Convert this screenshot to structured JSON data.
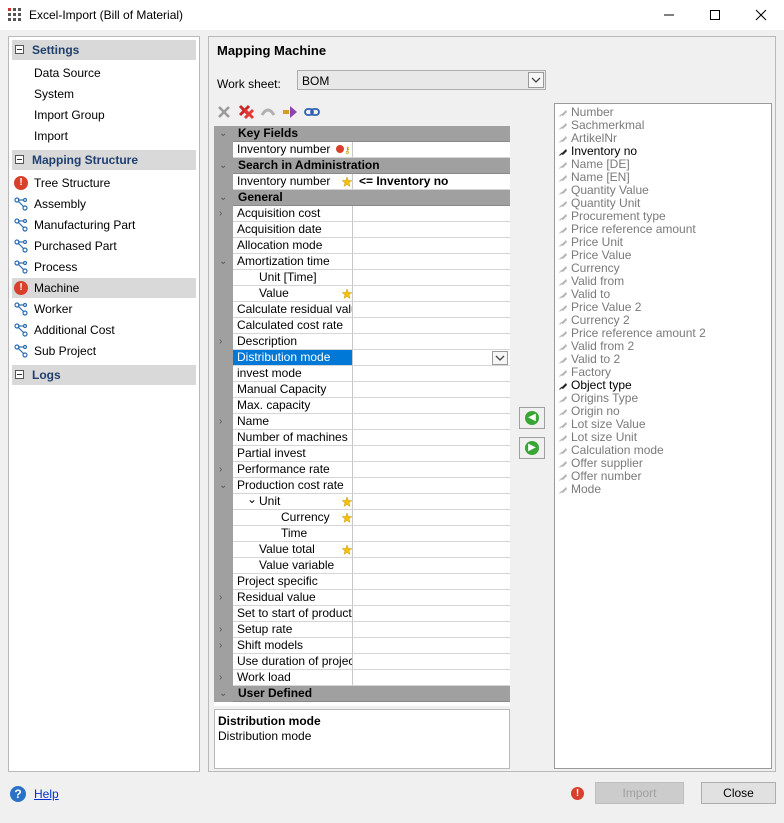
{
  "window": {
    "title": "Excel-Import (Bill of Material)"
  },
  "nav": {
    "settings_header": "Settings",
    "settings_items": [
      "Data Source",
      "System",
      "Import Group",
      "Import"
    ],
    "mapping_header": "Mapping Structure",
    "mapping_items": [
      {
        "label": "Tree Structure",
        "icon": "error-icon"
      },
      {
        "label": "Assembly",
        "icon": "structure-icon"
      },
      {
        "label": "Manufacturing Part",
        "icon": "structure-icon"
      },
      {
        "label": "Purchased Part",
        "icon": "structure-icon"
      },
      {
        "label": "Process",
        "icon": "structure-icon"
      },
      {
        "label": "Machine",
        "icon": "error-icon",
        "selected": true
      },
      {
        "label": "Worker",
        "icon": "structure-icon"
      },
      {
        "label": "Additional Cost",
        "icon": "structure-icon"
      },
      {
        "label": "Sub Project",
        "icon": "structure-icon"
      }
    ],
    "logs_header": "Logs"
  },
  "main": {
    "title": "Mapping Machine",
    "worksheet_label": "Work sheet:",
    "worksheet_value": "BOM"
  },
  "grid": {
    "categories": {
      "key_fields": "Key Fields",
      "search": "Search in Administration",
      "general": "General",
      "user_defined": "User Defined"
    },
    "key_rows": [
      {
        "label": "Inventory number",
        "value": ""
      }
    ],
    "search_rows": [
      {
        "label": "Inventory number",
        "value": "<= Inventory no"
      }
    ],
    "general_rows": [
      {
        "label": "Acquisition cost",
        "chev": "›"
      },
      {
        "label": "Acquisition date"
      },
      {
        "label": "Allocation mode"
      },
      {
        "label": "Amortization time",
        "chev": "⌄"
      },
      {
        "label": "Unit  [Time]",
        "indent": 1
      },
      {
        "label": "Value",
        "indent": 1,
        "star": true
      },
      {
        "label": "Calculate residual value"
      },
      {
        "label": "Calculated cost rate"
      },
      {
        "label": "Description",
        "chev": "›"
      },
      {
        "label": "Distribution mode",
        "selected": true,
        "dropdown": true
      },
      {
        "label": "invest mode"
      },
      {
        "label": "Manual Capacity"
      },
      {
        "label": "Max. capacity"
      },
      {
        "label": "Name",
        "chev": "›"
      },
      {
        "label": "Number of machines"
      },
      {
        "label": "Partial invest"
      },
      {
        "label": "Performance rate",
        "chev": "›"
      },
      {
        "label": "Production cost rate",
        "chev": "⌄"
      },
      {
        "label": "Unit",
        "indent": 1,
        "subchev": "⌄",
        "star": true
      },
      {
        "label": "Currency",
        "indent": 2,
        "star": true
      },
      {
        "label": "Time",
        "indent": 2
      },
      {
        "label": "Value total",
        "indent": 1,
        "star": true
      },
      {
        "label": "Value variable",
        "indent": 1
      },
      {
        "label": "Project specific"
      },
      {
        "label": "Residual value",
        "chev": "›"
      },
      {
        "label": "Set to start of production"
      },
      {
        "label": "Setup rate",
        "chev": "›"
      },
      {
        "label": "Shift models",
        "chev": "›"
      },
      {
        "label": "Use duration of projects"
      },
      {
        "label": "Work load",
        "chev": "›"
      }
    ]
  },
  "description": {
    "title": "Distribution mode",
    "text": "Distribution mode"
  },
  "fields": [
    {
      "label": "Number"
    },
    {
      "label": "Sachmerkmal"
    },
    {
      "label": "ArtikelNr"
    },
    {
      "label": "Inventory no",
      "used": true
    },
    {
      "label": "Name [DE]"
    },
    {
      "label": "Name [EN]"
    },
    {
      "label": "Quantity Value"
    },
    {
      "label": "Quantity Unit"
    },
    {
      "label": "Procurement type"
    },
    {
      "label": "Price reference amount"
    },
    {
      "label": "Price Unit"
    },
    {
      "label": "Price Value"
    },
    {
      "label": "Currency"
    },
    {
      "label": "Valid from"
    },
    {
      "label": "Valid to"
    },
    {
      "label": "Price Value 2"
    },
    {
      "label": "Currency 2"
    },
    {
      "label": "Price reference amount 2"
    },
    {
      "label": "Valid from 2"
    },
    {
      "label": "Valid to 2"
    },
    {
      "label": "Factory"
    },
    {
      "label": "Object type",
      "used": true
    },
    {
      "label": "Origins Type"
    },
    {
      "label": "Origin no"
    },
    {
      "label": "Lot size Value"
    },
    {
      "label": "Lot size Unit"
    },
    {
      "label": "Calculation mode"
    },
    {
      "label": "Offer supplier"
    },
    {
      "label": "Offer number"
    },
    {
      "label": "Mode"
    }
  ],
  "footer": {
    "help_label": "Help",
    "import_label": "Import",
    "close_label": "Close"
  },
  "colors": {
    "selection": "#0078d7",
    "category_band": "#a0a0a0",
    "error": "#d9402b",
    "ok_arrow": "#38a534"
  }
}
